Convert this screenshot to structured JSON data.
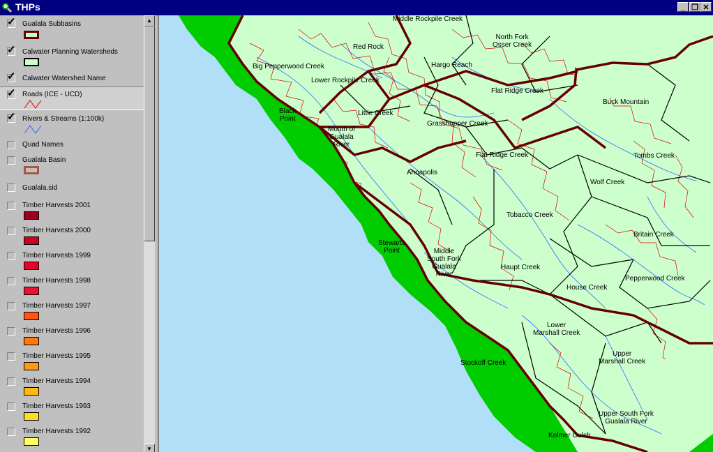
{
  "window": {
    "title": "THPs"
  },
  "layers": [
    {
      "name": "Gualala Subbasins",
      "checked": true
    },
    {
      "name": "Calwater Planning Watersheds",
      "checked": true
    },
    {
      "name": "Calwater Watershed Name",
      "checked": true
    },
    {
      "name": "Roads (ICE - UCD)",
      "checked": true
    },
    {
      "name": "Rivers & Streams (1:100k)",
      "checked": true
    },
    {
      "name": "Quad Names",
      "checked": false
    },
    {
      "name": "Gualala Basin",
      "checked": false
    },
    {
      "name": "Gualala.sid",
      "checked": false
    },
    {
      "name": "Timber Harvests 2001",
      "checked": false,
      "color": "#990022"
    },
    {
      "name": "Timber Harvests 2000",
      "checked": false,
      "color": "#cc0022"
    },
    {
      "name": "Timber Harvests  1999",
      "checked": false,
      "color": "#e8002a"
    },
    {
      "name": "Timber Harvests 1998",
      "checked": false,
      "color": "#ee1133"
    },
    {
      "name": "Timber Harvests 1997",
      "checked": false,
      "color": "#ff5511"
    },
    {
      "name": "Timber Harvests  1996",
      "checked": false,
      "color": "#ff7711"
    },
    {
      "name": "Timber Harvests  1995",
      "checked": false,
      "color": "#ff9911"
    },
    {
      "name": "Timber Harvests 1994",
      "checked": false,
      "color": "#ffbb11"
    },
    {
      "name": "Timber Harvests  1993",
      "checked": false,
      "color": "#ffdd22"
    },
    {
      "name": "Timber Harvests 1992",
      "checked": false,
      "color": "#ffff66"
    }
  ],
  "map": {
    "colors": {
      "ocean": "#b0dff7",
      "land": "#00cc00",
      "watershed": "#ccffcc",
      "roads": "#dd0000",
      "streams": "#3366ff",
      "subbasin": "#660000"
    },
    "labels": [
      {
        "id": "middle-rockpile-creek",
        "text": "Middle Rockpile Creek"
      },
      {
        "id": "north-fork-osser-creek",
        "text": "North Fork\nOsser Creek"
      },
      {
        "id": "red-rock",
        "text": "Red Rock"
      },
      {
        "id": "big-pepperwood-creek",
        "text": "Big Pepperwood Creek"
      },
      {
        "id": "hargo-reach",
        "text": "Hargo Reach"
      },
      {
        "id": "lower-rockpile-creek",
        "text": "Lower Rockpile Creek"
      },
      {
        "id": "flat-ridge-creek-north",
        "text": "Flat Ridge Creek"
      },
      {
        "id": "buck-mountain",
        "text": "Buck Mountain"
      },
      {
        "id": "black-point",
        "text": "Black\nPoint"
      },
      {
        "id": "little-creek",
        "text": "Little Creek"
      },
      {
        "id": "grasshopper-creek",
        "text": "Grasshopper Creek"
      },
      {
        "id": "mouth-of-gualala-river",
        "text": "Mouth of\nGualala\nRiver"
      },
      {
        "id": "flat-ridge-creek-south",
        "text": "Flat Ridge Creek"
      },
      {
        "id": "tombs-creek",
        "text": "Tombs Creek"
      },
      {
        "id": "annapolis",
        "text": "Annapolis"
      },
      {
        "id": "wolf-creek",
        "text": "Wolf Creek"
      },
      {
        "id": "tobacco-creek",
        "text": "Tobacco Creek"
      },
      {
        "id": "britain-creek",
        "text": "Britain Creek"
      },
      {
        "id": "stewarts-point",
        "text": "Stewarts\nPoint"
      },
      {
        "id": "middle-south-fork-gualala-river",
        "text": "Middle\nSouth Fork\nGualala\nRiver"
      },
      {
        "id": "haupt-creek",
        "text": "Haupt Creek"
      },
      {
        "id": "pepperwood-creek",
        "text": "Pepperwood Creek"
      },
      {
        "id": "house-creek",
        "text": "House Creek"
      },
      {
        "id": "lower-marshall-creek",
        "text": "Lower\nMarshall Creek"
      },
      {
        "id": "upper-marshall-creek",
        "text": "Upper\nMarshall Creek"
      },
      {
        "id": "stockoff-creek",
        "text": "Stockoff Creek"
      },
      {
        "id": "upper-south-fork-gualala-river",
        "text": "Upper South Fork\nGualala River"
      },
      {
        "id": "kolmer-gulch",
        "text": "Kolmer Gulch"
      }
    ]
  }
}
